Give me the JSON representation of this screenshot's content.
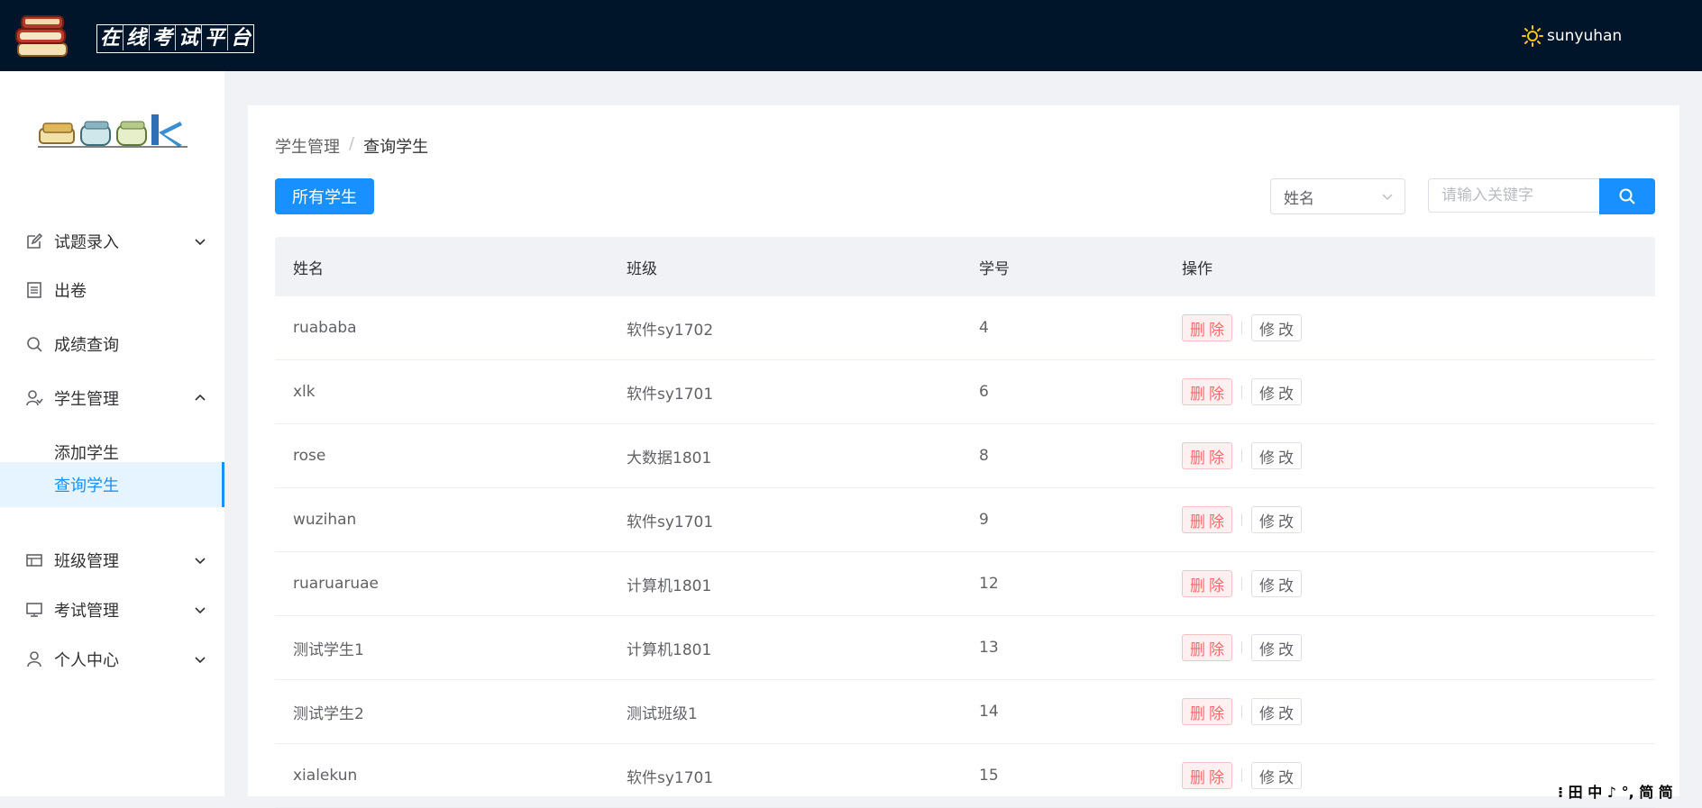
{
  "header": {
    "title_chars": [
      "在",
      "线",
      "考",
      "试",
      "平",
      "台"
    ],
    "username": "sunyuhan"
  },
  "sidebar": {
    "items": [
      {
        "label": "试题录入",
        "icon": "edit-icon",
        "expandable": true,
        "expanded": false
      },
      {
        "label": "出卷",
        "icon": "document-icon",
        "expandable": false
      },
      {
        "label": "成绩查询",
        "icon": "search-icon",
        "expandable": false
      },
      {
        "label": "学生管理",
        "icon": "student-icon",
        "expandable": true,
        "expanded": true
      },
      {
        "label": "添加学生",
        "sub": true
      },
      {
        "label": "查询学生",
        "sub": true,
        "active": true
      },
      {
        "label": "班级管理",
        "icon": "table-icon",
        "expandable": true,
        "expanded": false
      },
      {
        "label": "考试管理",
        "icon": "monitor-icon",
        "expandable": true,
        "expanded": false
      },
      {
        "label": "个人中心",
        "icon": "user-icon",
        "expandable": true,
        "expanded": false
      }
    ]
  },
  "breadcrumb": {
    "parent": "学生管理",
    "separator": "/",
    "current": "查询学生"
  },
  "toolbar": {
    "all_students_label": "所有学生",
    "filter_select_value": "姓名",
    "search_placeholder": "请输入关键字"
  },
  "table": {
    "headers": [
      "姓名",
      "班级",
      "学号",
      "操作"
    ],
    "delete_label": "删除",
    "edit_label": "修改",
    "rows": [
      {
        "name": "ruababa",
        "class": "软件sy1702",
        "id": "4"
      },
      {
        "name": "xlk",
        "class": "软件sy1701",
        "id": "6"
      },
      {
        "name": "rose",
        "class": "大数据1801",
        "id": "8"
      },
      {
        "name": "wuzihan",
        "class": "软件sy1701",
        "id": "9"
      },
      {
        "name": "ruaruaruae",
        "class": "计算机1801",
        "id": "12"
      },
      {
        "name": "测试学生1",
        "class": "计算机1801",
        "id": "13"
      },
      {
        "name": "测试学生2",
        "class": "测试班级1",
        "id": "14"
      },
      {
        "name": "xialekun",
        "class": "软件sy1701",
        "id": "15"
      }
    ]
  },
  "ime_bar": {
    "text": "⁝ 田 中 ♪ °, 简 简"
  },
  "colors": {
    "header_bg": "#001529",
    "accent": "#1890ff",
    "danger": "#f56c6c"
  }
}
